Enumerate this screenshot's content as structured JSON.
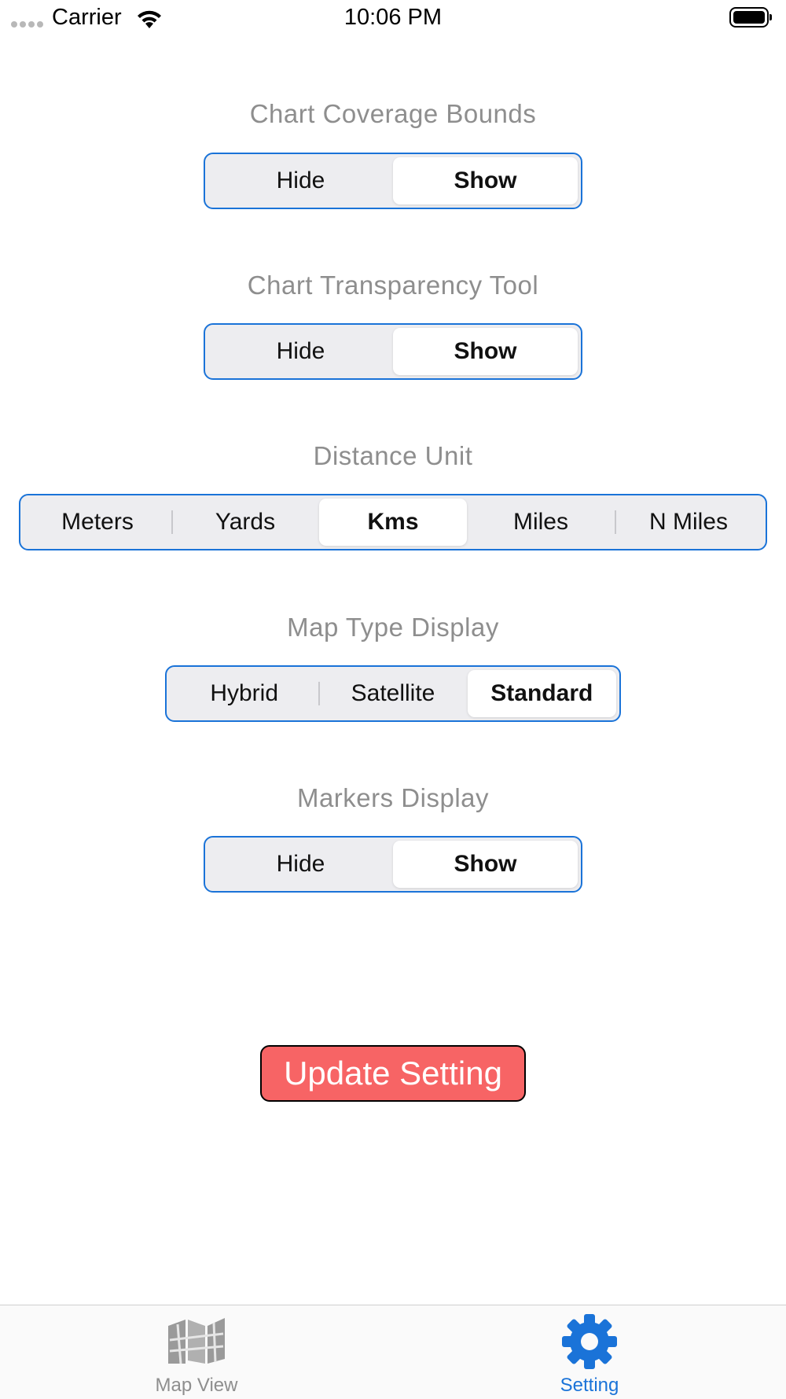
{
  "status_bar": {
    "carrier": "Carrier",
    "time": "10:06 PM"
  },
  "sections": [
    {
      "title": "Chart Coverage Bounds",
      "options": [
        "Hide",
        "Show"
      ],
      "selected": "Show"
    },
    {
      "title": "Chart Transparency Tool",
      "options": [
        "Hide",
        "Show"
      ],
      "selected": "Show"
    },
    {
      "title": "Distance Unit",
      "options": [
        "Meters",
        "Yards",
        "Kms",
        "Miles",
        "N Miles"
      ],
      "selected": "Kms"
    },
    {
      "title": "Map Type Display",
      "options": [
        "Hybrid",
        "Satellite",
        "Standard"
      ],
      "selected": "Standard"
    },
    {
      "title": "Markers Display",
      "options": [
        "Hide",
        "Show"
      ],
      "selected": "Show"
    }
  ],
  "update_button": {
    "label": "Update Setting",
    "color": "#f76465"
  },
  "tab_bar": {
    "tabs": [
      {
        "label": "Map View",
        "icon": "map-icon",
        "active": false
      },
      {
        "label": "Setting",
        "icon": "gear-icon",
        "active": true
      }
    ]
  },
  "colors": {
    "accent": "#1a73d8",
    "segment_background": "#ededf0",
    "heading_text": "#8e8e8e"
  }
}
